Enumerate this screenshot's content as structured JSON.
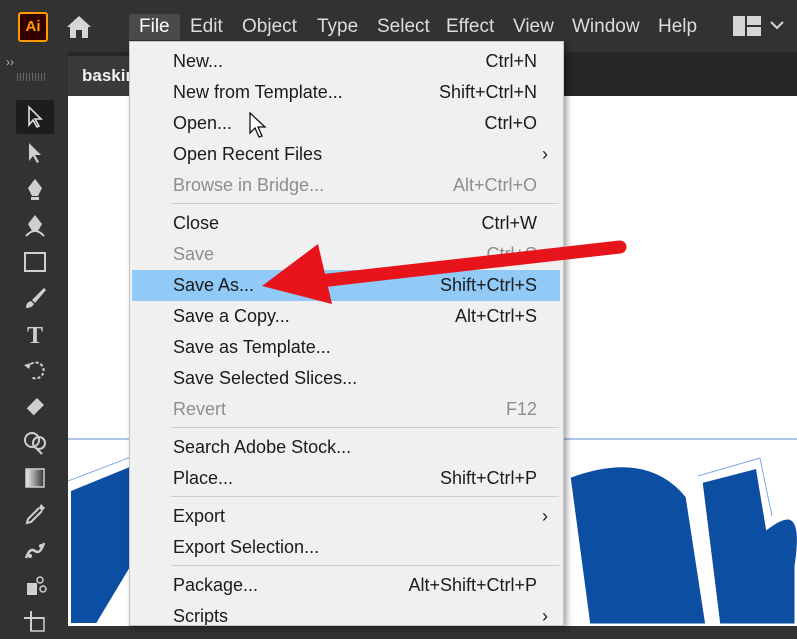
{
  "app": {
    "logo_text": "Ai",
    "brand_color": "#ff9a00"
  },
  "menubar": {
    "items": [
      "File",
      "Edit",
      "Object",
      "Type",
      "Select",
      "Effect",
      "View",
      "Window",
      "Help"
    ],
    "active": "File"
  },
  "toolbar": {
    "collapse_glyph": "››",
    "tools": [
      "selection-tool",
      "direct-selection-tool",
      "pen-tool",
      "curvature-tool",
      "rectangle-tool",
      "paintbrush-tool",
      "type-tool",
      "rotate-tool",
      "eraser-tool",
      "shape-builder-tool",
      "gradient-tool",
      "eyedropper-tool",
      "puppet-warp-tool",
      "symbol-sprayer-tool",
      "artboard-tool"
    ],
    "selected": "selection-tool"
  },
  "document": {
    "tab_title": "baskin"
  },
  "file_menu": {
    "items": [
      {
        "label": "New...",
        "shortcut": "Ctrl+N"
      },
      {
        "label": "New from Template...",
        "shortcut": "Shift+Ctrl+N"
      },
      {
        "label": "Open...",
        "shortcut": "Ctrl+O"
      },
      {
        "label": "Open Recent Files",
        "shortcut": "",
        "submenu": "›"
      },
      {
        "label": "Browse in Bridge...",
        "shortcut": "Alt+Ctrl+O",
        "disabled": true
      },
      {
        "label": "Close",
        "shortcut": "Ctrl+W"
      },
      {
        "label": "Save",
        "shortcut": "Ctrl+S",
        "disabled": true
      },
      {
        "label": "Save As...",
        "shortcut": "Shift+Ctrl+S",
        "highlighted": true
      },
      {
        "label": "Save a Copy...",
        "shortcut": "Alt+Ctrl+S"
      },
      {
        "label": "Save as Template...",
        "shortcut": ""
      },
      {
        "label": "Save Selected Slices...",
        "shortcut": ""
      },
      {
        "label": "Revert",
        "shortcut": "F12",
        "disabled": true
      },
      {
        "label": "Search Adobe Stock...",
        "shortcut": ""
      },
      {
        "label": "Place...",
        "shortcut": "Shift+Ctrl+P"
      },
      {
        "label": "Export",
        "shortcut": "",
        "submenu": "›"
      },
      {
        "label": "Export Selection...",
        "shortcut": ""
      },
      {
        "label": "Package...",
        "shortcut": "Alt+Shift+Ctrl+P"
      },
      {
        "label": "Scripts",
        "shortcut": "",
        "submenu": "›"
      }
    ]
  },
  "colors": {
    "highlight": "#91c9f7",
    "annotation_arrow": "#e8141b",
    "artwork_blue": "#0c4ea2"
  }
}
